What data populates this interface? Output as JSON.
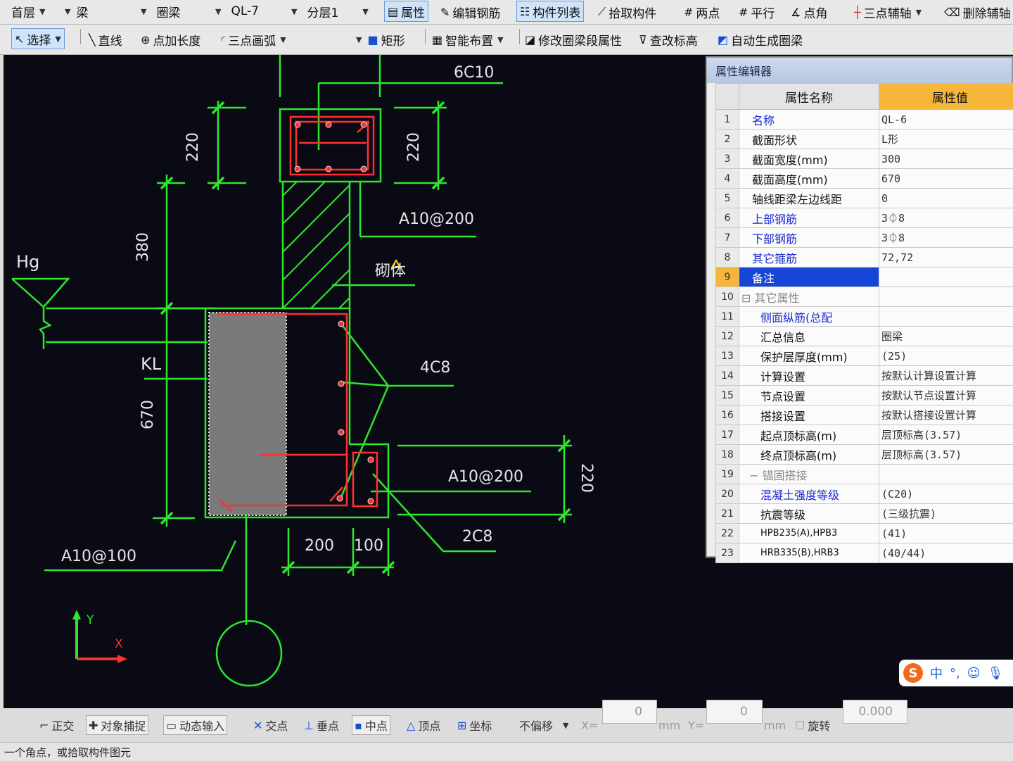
{
  "toolbar1": {
    "floor": "首层",
    "category": "梁",
    "type": "圈梁",
    "component": "QL-7",
    "layer": "分层1",
    "buttons": [
      "属性",
      "编辑钢筋",
      "构件列表",
      "拾取构件",
      "两点",
      "平行",
      "点角",
      "三点辅轴",
      "删除辅轴"
    ]
  },
  "toolbar2": {
    "select": "选择",
    "line": "直线",
    "point_length": "点加长度",
    "arc": "三点画弧",
    "rect": "矩形",
    "smart": "智能布置",
    "modify": "修改圈梁段属性",
    "change_elev": "查改标高",
    "auto_gen": "自动生成圈梁"
  },
  "drawing": {
    "labels": {
      "top_rebar": "6C10",
      "dim_220_left": "220",
      "dim_220_right": "220",
      "stirrup_top": "A10@200",
      "dim_380": "380",
      "hg": "Hg",
      "masonry": "砌体",
      "kl": "KL",
      "rebar_4c8": "4C8",
      "dim_670": "670",
      "stirrup_mid": "A10@200",
      "dim_220_side": "220",
      "stirrup_bottom": "A10@100",
      "dim_200": "200",
      "dim_100": "100",
      "rebar_2c8": "2C8"
    },
    "axis": {
      "y": "Y",
      "x": "X"
    }
  },
  "props": {
    "title": "属性编辑器",
    "col_name": "属性名称",
    "col_value": "属性值",
    "rows": [
      {
        "no": "1",
        "name": "名称",
        "value": "QL-6"
      },
      {
        "no": "2",
        "name": "截面形状",
        "value": "L形"
      },
      {
        "no": "3",
        "name": "截面宽度(mm)",
        "value": "300"
      },
      {
        "no": "4",
        "name": "截面高度(mm)",
        "value": "670"
      },
      {
        "no": "5",
        "name": "轴线距梁左边线距",
        "value": "0"
      },
      {
        "no": "6",
        "name": "上部钢筋",
        "value": "3⏀8"
      },
      {
        "no": "7",
        "name": "下部钢筋",
        "value": "3⏀8"
      },
      {
        "no": "8",
        "name": "其它箍筋",
        "value": "72,72"
      },
      {
        "no": "9",
        "name": "备注",
        "value": ""
      },
      {
        "no": "10",
        "name": "其它属性",
        "value": ""
      },
      {
        "no": "11",
        "name": "侧面纵筋(总配",
        "value": ""
      },
      {
        "no": "12",
        "name": "汇总信息",
        "value": "圈梁"
      },
      {
        "no": "13",
        "name": "保护层厚度(mm)",
        "value": "(25)"
      },
      {
        "no": "14",
        "name": "计算设置",
        "value": "按默认计算设置计算"
      },
      {
        "no": "15",
        "name": "节点设置",
        "value": "按默认节点设置计算"
      },
      {
        "no": "16",
        "name": "搭接设置",
        "value": "按默认搭接设置计算"
      },
      {
        "no": "17",
        "name": "起点顶标高(m)",
        "value": "层顶标高(3.57)"
      },
      {
        "no": "18",
        "name": "终点顶标高(m)",
        "value": "层顶标高(3.57)"
      },
      {
        "no": "19",
        "name": "锚固搭接",
        "value": ""
      },
      {
        "no": "20",
        "name": "混凝土强度等级",
        "value": "(C20)"
      },
      {
        "no": "21",
        "name": "抗震等级",
        "value": "(三级抗震)"
      },
      {
        "no": "22",
        "name": "HPB235(A),HPB3",
        "value": "(41)"
      },
      {
        "no": "23",
        "name": "HRB335(B),HRB3",
        "value": "(40/44)"
      }
    ]
  },
  "ime": {
    "logo": "S",
    "lang": "中"
  },
  "statusbar": {
    "ortho": "正交",
    "snap": "对象捕捉",
    "dyn": "动态输入",
    "intersect": "交点",
    "perp": "垂点",
    "mid": "中点",
    "vertex": "顶点",
    "coord": "坐标",
    "no_offset": "不偏移",
    "x_label": "X=",
    "x_val": "0",
    "mm1": "mm",
    "y_label": "Y=",
    "y_val": "0",
    "mm2": "mm",
    "rotate": "旋转",
    "rot_val": "0.000",
    "prompt": "一个角点，或拾取构件图元"
  },
  "colors": {
    "canvas": "#0a0a14",
    "green": "#2ee62e",
    "red": "#ff3030",
    "white": "#e6e6e6",
    "accent": "#f5b63a",
    "select": "#1546d6"
  }
}
